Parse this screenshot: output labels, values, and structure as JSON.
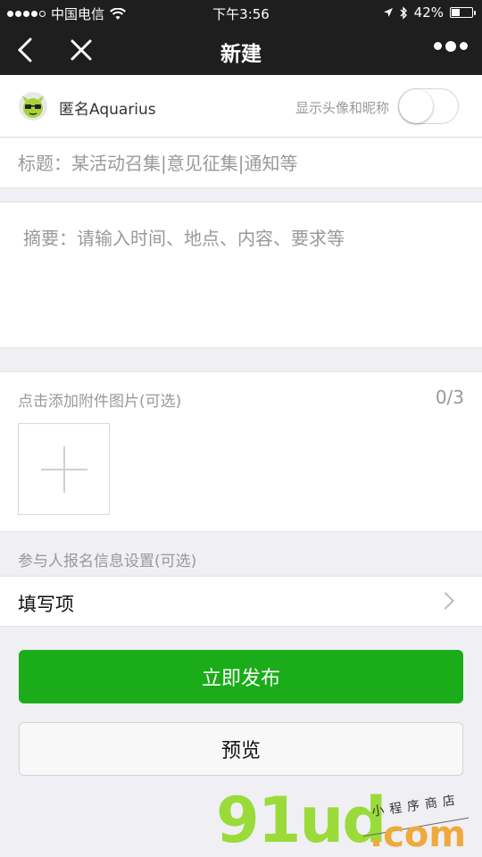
{
  "status_bar": {
    "carrier": "中国电信",
    "time": "下午3:56",
    "battery": "42%",
    "battery_level": 0.42
  },
  "nav": {
    "title": "新建",
    "back_icon": "chevron-left-icon",
    "close_icon": "close-icon",
    "more_icon": "more-dots-icon"
  },
  "anonymous": {
    "name": "匿名Aquarius",
    "toggle_label": "显示头像和昵称",
    "toggle_on": false
  },
  "form": {
    "title_placeholder": "标题：某活动召集|意见征集|通知等",
    "summary_placeholder": "摘要：请输入时间、地点、内容、要求等"
  },
  "attachments": {
    "label": "点击添加附件图片(可选)",
    "count": "0/3"
  },
  "participant": {
    "hint": "参与人报名信息设置(可选)",
    "fields_label": "填写项"
  },
  "actions": {
    "publish": "立即发布",
    "preview": "预览"
  },
  "watermark": {
    "main": "91ud",
    "com": ".com",
    "sub": "小程序商店"
  },
  "colors": {
    "primary_green": "#1aad19",
    "nav_bg": "#1e1e1e",
    "placeholder": "#999999"
  }
}
